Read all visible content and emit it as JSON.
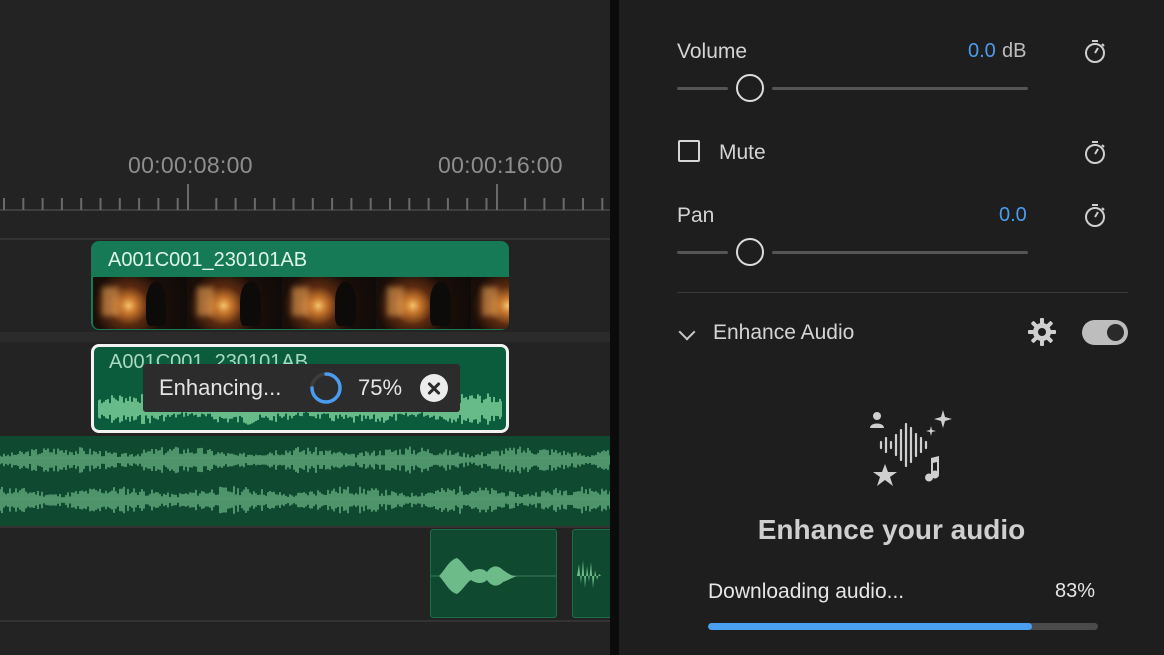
{
  "timeline": {
    "timecodes": [
      "00:00:08:00",
      "00:00:16:00"
    ],
    "video_clip": {
      "name": "A001C001_230101AB"
    },
    "audio_clip": {
      "name": "A001C001_230101AB"
    },
    "enhancing": {
      "label": "Enhancing...",
      "percent": "75%",
      "progress": 0.75
    }
  },
  "inspector": {
    "volume": {
      "label": "Volume",
      "value": "0.0",
      "unit": "dB"
    },
    "mute": {
      "label": "Mute",
      "checked": false
    },
    "pan": {
      "label": "Pan",
      "value": "0.0"
    },
    "enhance_audio": {
      "label": "Enhance Audio",
      "enabled": true,
      "hero_title": "Enhance your audio",
      "download_label": "Downloading audio...",
      "download_percent": "83%",
      "download_progress": 0.83
    }
  },
  "colors": {
    "accent": "#4a9cf0",
    "video_clip": "#157a55",
    "audio_clip": "#0b5c3c",
    "waveform": "#7fd39b"
  },
  "icons": [
    "stopwatch-icon",
    "chevron-down-icon",
    "gear-icon",
    "toggle-switch",
    "close-icon",
    "spinner-icon",
    "enhance-audio-icon"
  ]
}
